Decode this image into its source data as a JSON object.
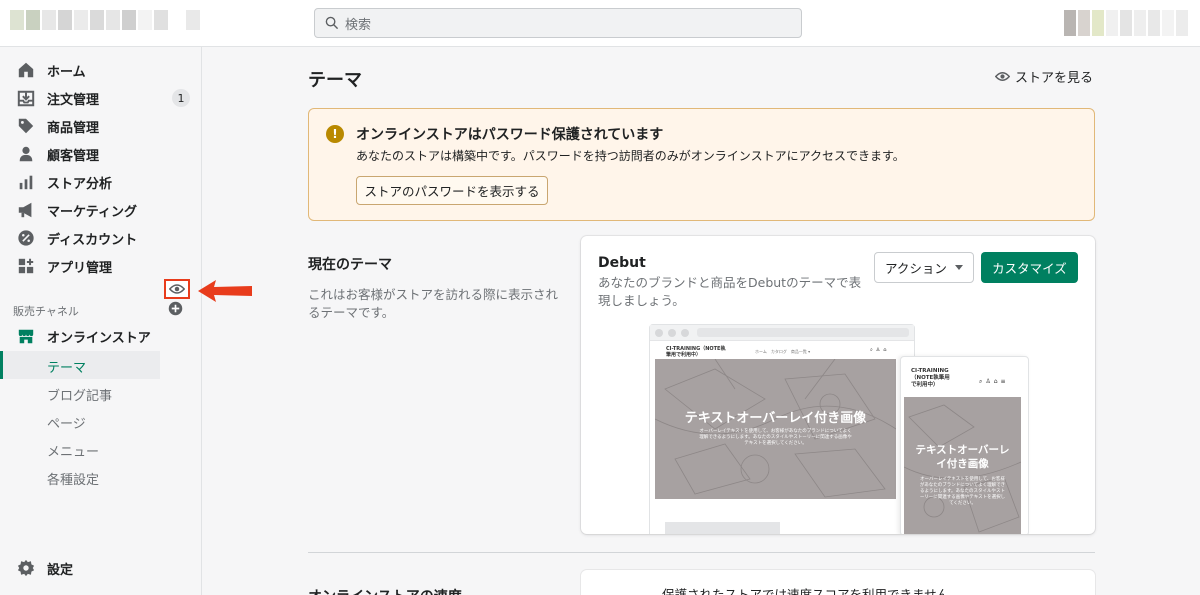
{
  "topbar": {
    "search_placeholder": "検索"
  },
  "sidebar": {
    "items": [
      {
        "label": "ホーム",
        "icon": "home-icon"
      },
      {
        "label": "注文管理",
        "icon": "orders-icon",
        "badge": "1"
      },
      {
        "label": "商品管理",
        "icon": "tag-icon"
      },
      {
        "label": "顧客管理",
        "icon": "customer-icon"
      },
      {
        "label": "ストア分析",
        "icon": "analytics-icon"
      },
      {
        "label": "マーケティング",
        "icon": "megaphone-icon"
      },
      {
        "label": "ディスカウント",
        "icon": "discount-icon"
      },
      {
        "label": "アプリ管理",
        "icon": "apps-icon"
      }
    ],
    "channels_title": "販売チャネル",
    "online_store": "オンラインストア",
    "sub_items": [
      "テーマ",
      "ブログ記事",
      "ページ",
      "メニュー",
      "各種設定"
    ],
    "settings": "設定"
  },
  "page": {
    "title": "テーマ",
    "view_store": "ストアを見る"
  },
  "banner": {
    "title": "オンラインストアはパスワード保護されています",
    "text": "あなたのストアは構築中です。パスワードを持つ訪問者のみがオンラインストアにアクセスできます。",
    "button": "ストアのパスワードを表示する"
  },
  "current_theme": {
    "section_title": "現在のテーマ",
    "section_desc": "これはお客様がストアを訪れる際に表示されるテーマです。",
    "name": "Debut",
    "desc": "あなたのブランドと商品をDebutのテーマで表現しましょう。",
    "action_label": "アクション",
    "customize_label": "カスタマイズ"
  },
  "preview": {
    "desktop_store_name": "CI-TRAINING（NOTE執\n筆用で利用中）",
    "desktop_links": "ホーム　カタログ　商品一覧 ▾",
    "hero_title": "テキストオーバーレイ付き画像",
    "desktop_hero_sub": "オーバーレイテキストを使用して、お客様があなたのブランドについてよく\n理解できるようにします。あなたのスタイルやストーリーに関連する画像や\nテキストを選択してください。",
    "mobile_store_name": "CI-TRAINING\n（NOTE執筆用\nで利用中）",
    "mobile_hero_title": "テキストオーバーレ\nイ付き画像",
    "mobile_hero_sub": "オーバーレイテキストを使用して、お客様\nがあなたのブランドについてよく理解でき\nるようにします。あなたのスタイルやスト\nーリーに関連する画像やテキストを選択し\nてください。"
  },
  "speed": {
    "title": "オンラインストアの速度",
    "text": "保護されたストアでは速度スコアを利用できません。"
  },
  "colors": {
    "primary": "#008060",
    "warning_bg": "#fff5ea",
    "warning_border": "#e1b878",
    "annotation_red": "#e83c1c"
  }
}
